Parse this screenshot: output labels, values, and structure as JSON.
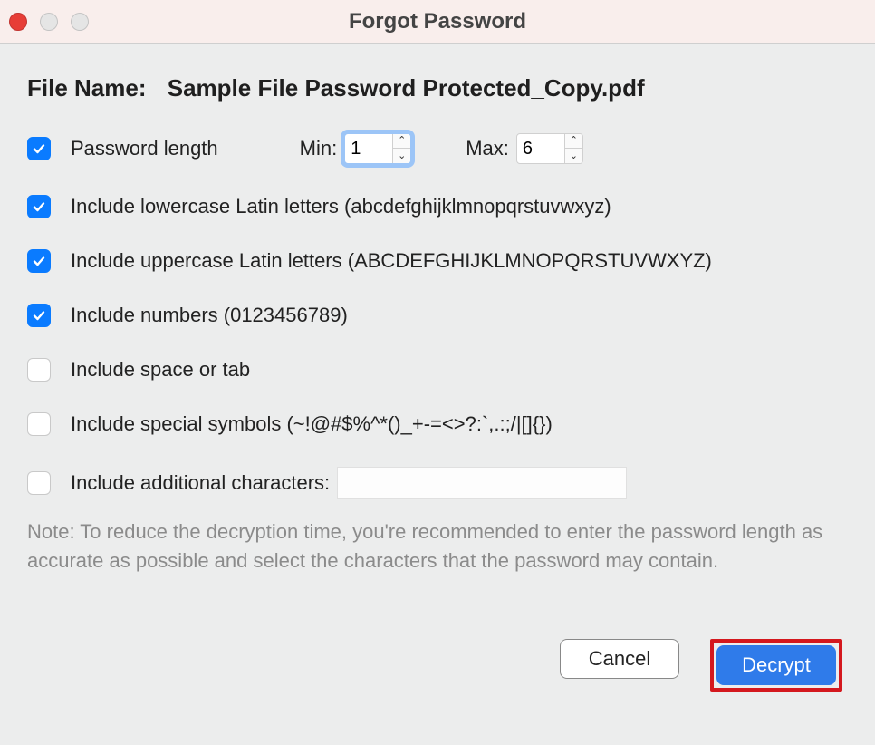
{
  "window": {
    "title": "Forgot Password"
  },
  "file": {
    "label": "File Name:",
    "value": "Sample File Password Protected_Copy.pdf"
  },
  "options": {
    "password_length": {
      "label": "Password length",
      "checked": true,
      "min_label": "Min:",
      "min_value": "1",
      "max_label": "Max:",
      "max_value": "6"
    },
    "lowercase": {
      "label": "Include lowercase Latin letters (abcdefghijklmnopqrstuvwxyz)",
      "checked": true
    },
    "uppercase": {
      "label": "Include uppercase Latin letters (ABCDEFGHIJKLMNOPQRSTUVWXYZ)",
      "checked": true
    },
    "numbers": {
      "label": "Include numbers (0123456789)",
      "checked": true
    },
    "space": {
      "label": "Include space or tab",
      "checked": false
    },
    "symbols": {
      "label": "Include special symbols (~!@#$%^*()_+-=<>?:`,.:;/|[]{})",
      "checked": false
    },
    "additional": {
      "label": "Include additional characters:",
      "checked": false,
      "value": ""
    }
  },
  "note": "Note: To reduce the decryption time, you're recommended to enter the password length as accurate as possible and select the characters that the password may contain.",
  "buttons": {
    "cancel": "Cancel",
    "decrypt": "Decrypt"
  }
}
